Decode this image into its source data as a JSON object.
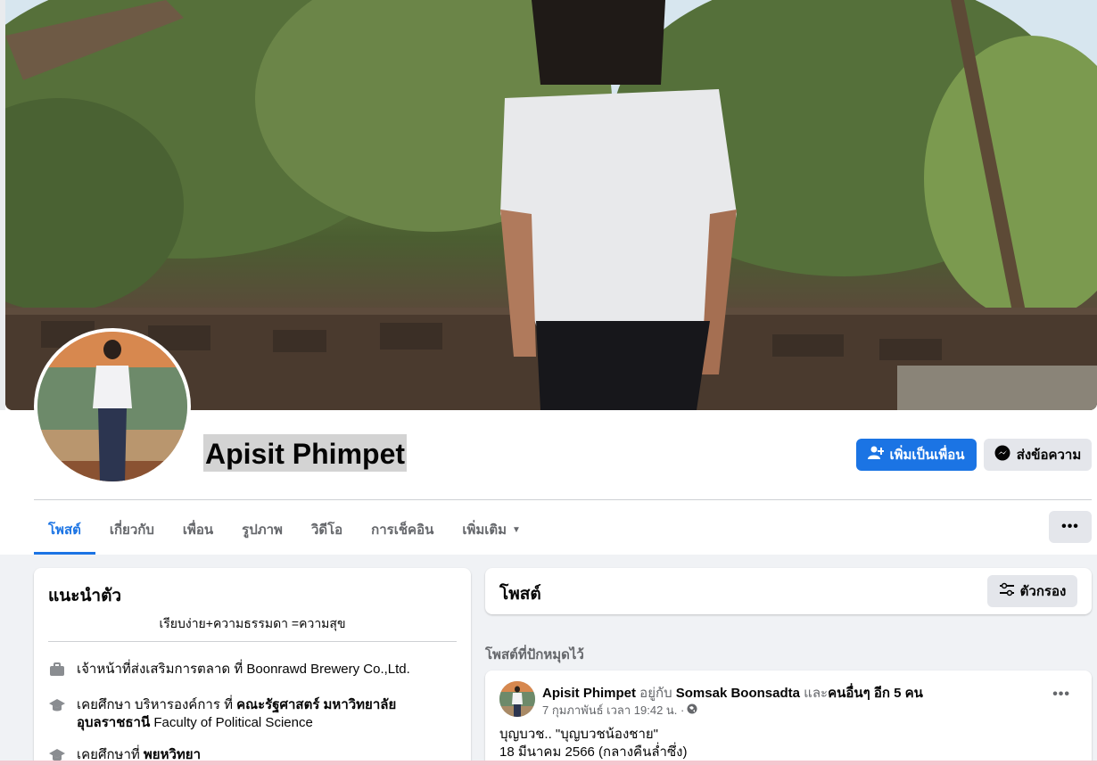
{
  "profile": {
    "name": "Apisit Phimpet",
    "add_friend_label": "เพิ่มเป็นเพื่อน",
    "message_label": "ส่งข้อความ"
  },
  "tabs": [
    {
      "label": "โพสต์",
      "active": true
    },
    {
      "label": "เกี่ยวกับ"
    },
    {
      "label": "เพื่อน"
    },
    {
      "label": "รูปภาพ"
    },
    {
      "label": "วิดีโอ"
    },
    {
      "label": "การเช็คอิน"
    },
    {
      "label": "เพิ่มเติม"
    }
  ],
  "more_button": "•••",
  "intro": {
    "title": "แนะนำตัว",
    "bio": "เรียบง่าย+ความธรรมดา =ความสุข",
    "work": {
      "prefix": "เจ้าหน้าที่ส่งเสริมการตลาด ที่ ",
      "place": "Boonrawd Brewery Co.,Ltd."
    },
    "education1": {
      "prefix": "เคยศึกษา บริหารองค์การ ที่ ",
      "bold": "คณะรัฐศาสตร์ มหาวิทยาลัย",
      "line2_bold": "อุบลราชธานี",
      "line2_rest": " Faculty of Political Science"
    },
    "education2": {
      "prefix": "เคยศึกษาที่ ",
      "bold": "พยหวิทยา"
    }
  },
  "posts": {
    "title": "โพสต์",
    "filter_label": "ตัวกรอง",
    "pinned_label": "โพสต์ที่ปักหมุดไว้"
  },
  "pinned_post": {
    "author": "Apisit Phimpet",
    "with_text": " อยู่กับ ",
    "tagged": "Somsak Boonsadta",
    "and_text": " และ",
    "others": "คนอื่นๆ อีก 5 คน",
    "timestamp": "7 กุมภาพันธ์ เวลา 19:42 น. ·",
    "line1": "บุญบวช.. \"บุญบวชน้องชาย\"",
    "line2": "18 มีนาคม 2566 (กลางคืนล่ำซึ่ง)"
  },
  "colors": {
    "accent": "#1b74e4",
    "muted": "#65676b",
    "button_gray": "#e4e6eb"
  }
}
